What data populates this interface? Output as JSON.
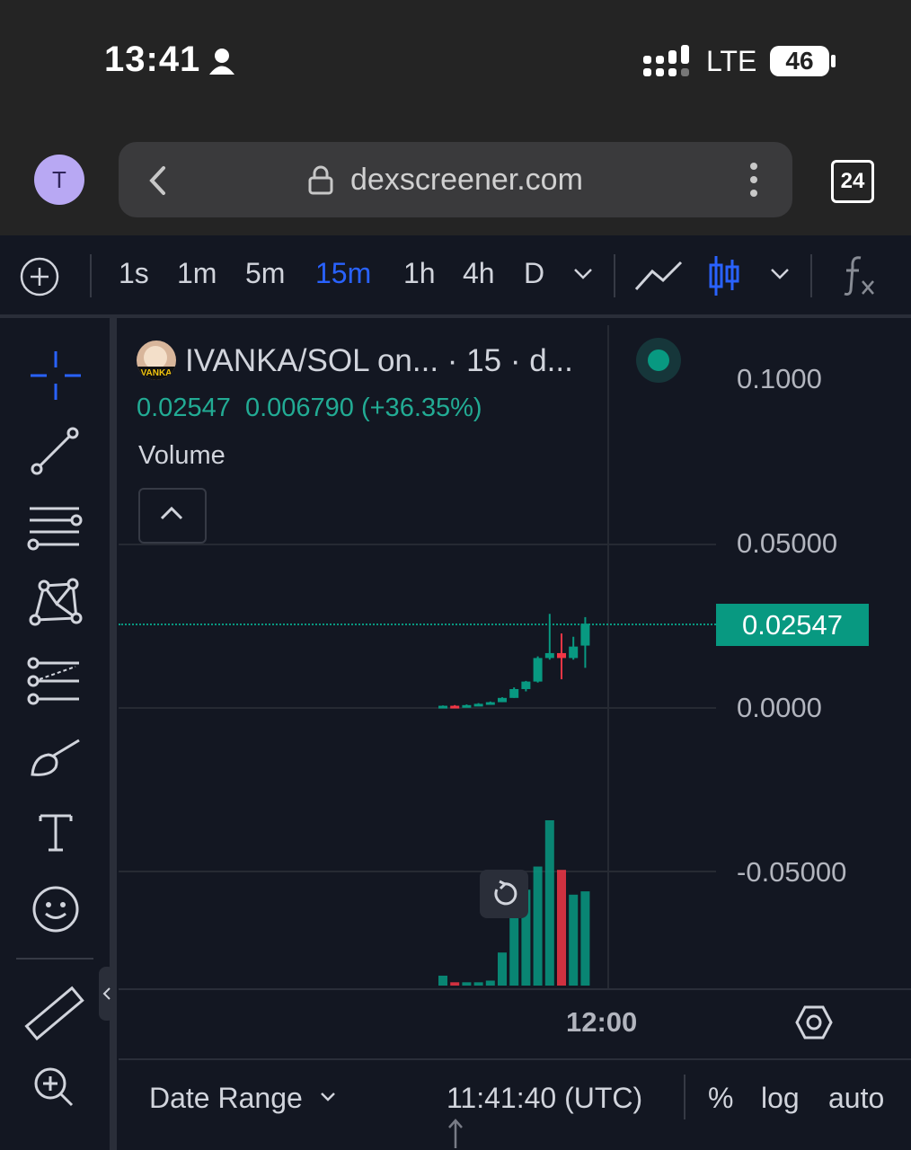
{
  "status_bar": {
    "time": "13:41",
    "network": "LTE",
    "battery": "46"
  },
  "browser": {
    "profile_initial": "T",
    "url": "dexscreener.com",
    "tab_count": "24"
  },
  "toolbar": {
    "timeframes": [
      "1s",
      "1m",
      "5m",
      "15m",
      "1h",
      "4h",
      "D"
    ],
    "active_timeframe": "15m",
    "icons": [
      "add-indicator-icon",
      "chevron-down-icon",
      "line-chart-icon",
      "candlestick-icon",
      "chevron-down-icon",
      "function-icon"
    ]
  },
  "left_tools": [
    "crosshair-icon",
    "trend-line-icon",
    "horizontal-lines-icon",
    "pattern-icon",
    "fib-icon",
    "brush-icon",
    "text-icon",
    "emoji-icon",
    "ruler-icon",
    "zoom-in-icon"
  ],
  "legend": {
    "title": "IVANKA/SOL on... · 15 · d...",
    "avatar_text": "VANKA",
    "price": "0.02547",
    "change": "0.006790 (+36.35%)",
    "volume_label": "Volume"
  },
  "price_axis": {
    "labels": [
      "0.1000",
      "0.05000",
      "0.0000",
      "-0.05000"
    ],
    "last_price": "0.02547"
  },
  "time_axis": {
    "label": "12:00"
  },
  "bottom_bar": {
    "date_range": "Date Range",
    "time": "11:41:40 (UTC)",
    "percent": "%",
    "log": "log",
    "auto": "auto"
  },
  "colors": {
    "up": "#089981",
    "down": "#f23645",
    "accent": "#2962ff",
    "background": "#131722"
  },
  "chart_data": {
    "type": "candlestick",
    "y_axis_labels": [
      0.1,
      0.05,
      0.0,
      -0.05
    ],
    "last_price": 0.02547,
    "candles": [
      {
        "o": 0.0,
        "h": 0.0005,
        "l": 0.0,
        "c": 0.0004,
        "dir": "up",
        "vol": 0.06
      },
      {
        "o": 0.0004,
        "h": 0.0006,
        "l": 0.0002,
        "c": 0.0003,
        "dir": "down",
        "vol": 0.02
      },
      {
        "o": 0.0003,
        "h": 0.0008,
        "l": 0.0003,
        "c": 0.0006,
        "dir": "up",
        "vol": 0.02
      },
      {
        "o": 0.0006,
        "h": 0.0012,
        "l": 0.0006,
        "c": 0.001,
        "dir": "up",
        "vol": 0.02
      },
      {
        "o": 0.001,
        "h": 0.0017,
        "l": 0.001,
        "c": 0.0015,
        "dir": "up",
        "vol": 0.03
      },
      {
        "o": 0.0015,
        "h": 0.003,
        "l": 0.0015,
        "c": 0.0028,
        "dir": "up",
        "vol": 0.2
      },
      {
        "o": 0.0028,
        "h": 0.006,
        "l": 0.0028,
        "c": 0.0055,
        "dir": "up",
        "vol": 0.45
      },
      {
        "o": 0.0055,
        "h": 0.008,
        "l": 0.0048,
        "c": 0.0078,
        "dir": "up",
        "vol": 0.58
      },
      {
        "o": 0.0078,
        "h": 0.0155,
        "l": 0.0075,
        "c": 0.015,
        "dir": "up",
        "vol": 0.72
      },
      {
        "o": 0.015,
        "h": 0.0285,
        "l": 0.0145,
        "c": 0.0165,
        "dir": "up",
        "vol": 1.0
      },
      {
        "o": 0.0165,
        "h": 0.0225,
        "l": 0.0085,
        "c": 0.015,
        "dir": "down",
        "vol": 0.7
      },
      {
        "o": 0.015,
        "h": 0.0215,
        "l": 0.0145,
        "c": 0.0185,
        "dir": "up",
        "vol": 0.55
      },
      {
        "o": 0.0188,
        "h": 0.0275,
        "l": 0.012,
        "c": 0.0255,
        "dir": "up",
        "vol": 0.57
      }
    ]
  }
}
